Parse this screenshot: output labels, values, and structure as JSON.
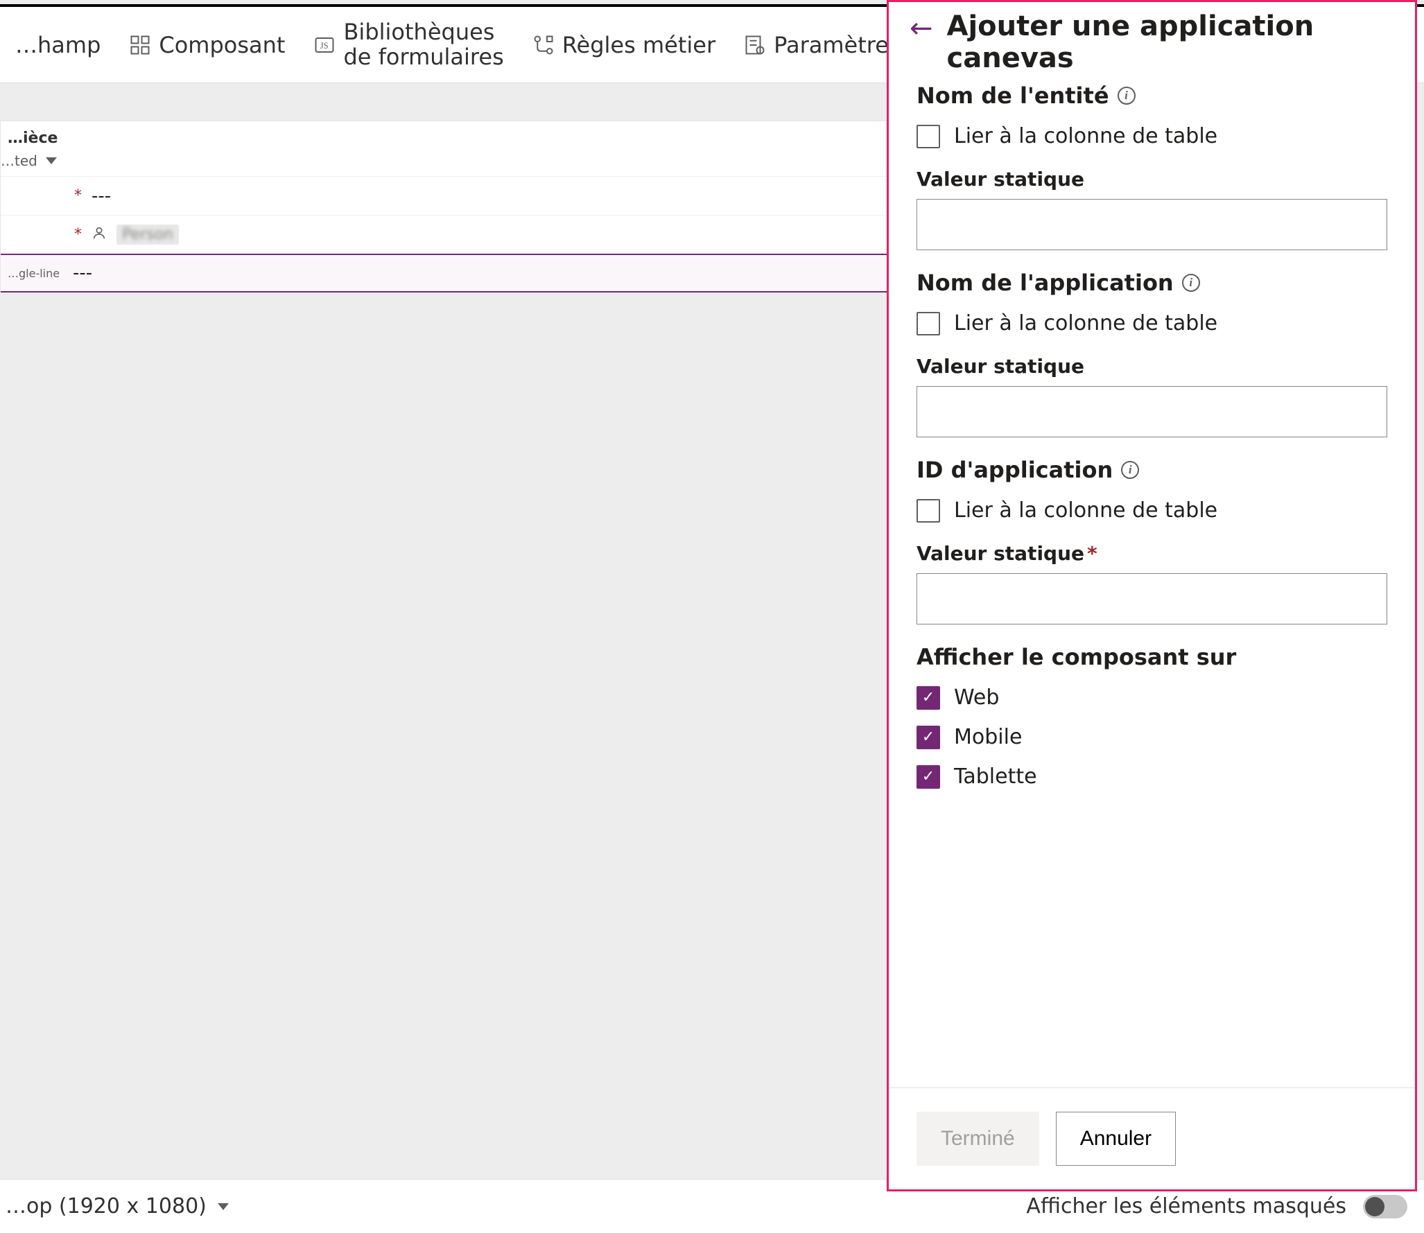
{
  "toolbar": {
    "add_field": "…hamp",
    "component": "Composant",
    "form_libraries_line1": "Bibliothèques",
    "form_libraries_line2": "de formulaires",
    "business_rules": "Règles métier",
    "form_settings": "Paramètres du…"
  },
  "form": {
    "card_title": "…ièce",
    "sub_label": "…ted",
    "rows": {
      "row1_placeholder": "---",
      "row2_label_fragment": "",
      "row2_person": "Person",
      "row3_label": "…gle-line",
      "row3_placeholder": "---"
    }
  },
  "statusbar": {
    "desktop": "…op (1920 x 1080)",
    "show_hidden": "Afficher les éléments masqués"
  },
  "panel": {
    "title": "Ajouter une application canevas",
    "sections": {
      "entity": {
        "label": "Nom de l'entité",
        "bind_to_col": "Lier à la colonne de table",
        "static_label": "Valeur statique"
      },
      "app_name": {
        "label": "Nom de l'application",
        "bind_to_col": "Lier à la colonne de table",
        "static_label": "Valeur statique"
      },
      "app_id": {
        "label": "ID d'application",
        "bind_to_col": "Lier à la colonne de table",
        "static_label": "Valeur statique"
      },
      "show_on": {
        "label": "Afficher le composant sur",
        "web": "Web",
        "mobile": "Mobile",
        "tablet": "Tablette"
      }
    },
    "footer": {
      "done": "Terminé",
      "cancel": "Annuler"
    }
  }
}
